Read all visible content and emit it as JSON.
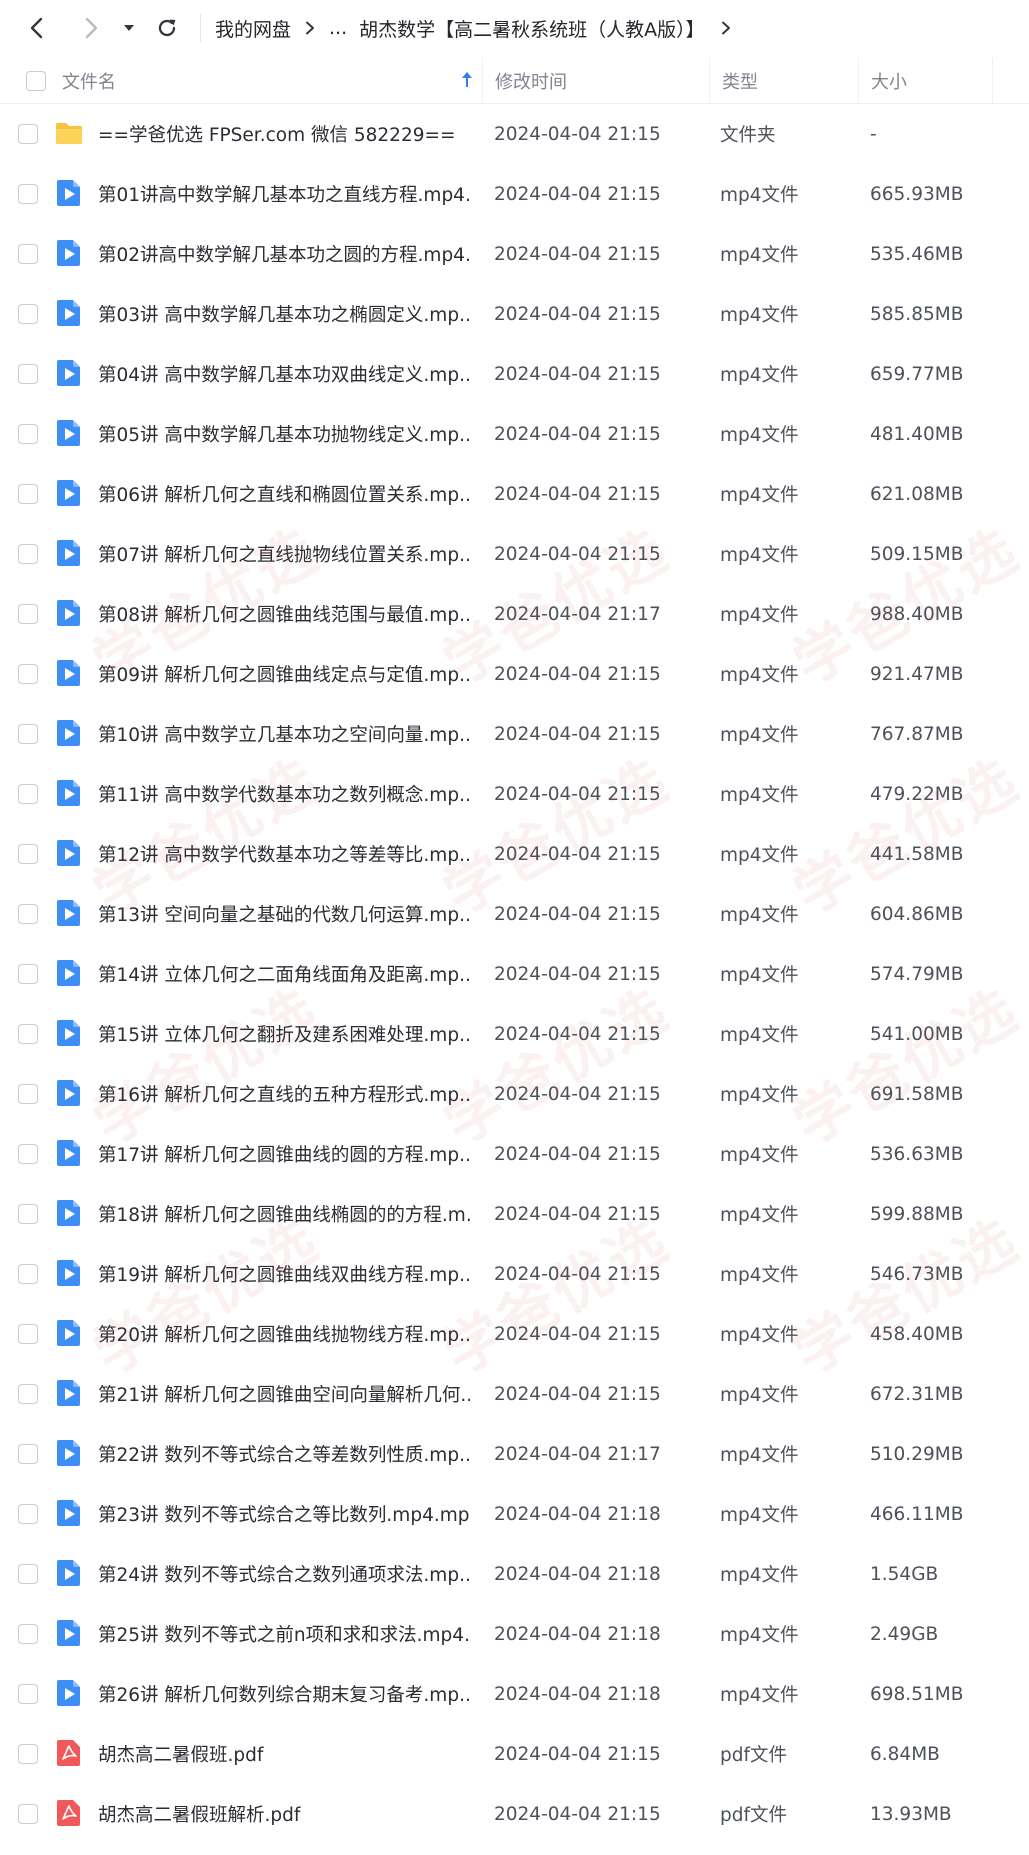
{
  "breadcrumb": {
    "root": "我的网盘",
    "ellipsis": "...",
    "current": "胡杰数学【高二暑秋系统班（人教A版）】"
  },
  "header": {
    "name": "文件名",
    "mtime": "修改时间",
    "type": "类型",
    "size": "大小"
  },
  "rows": [
    {
      "name": "==学爸优选 FPSer.com 微信 582229==",
      "mtime": "2024-04-04 21:15",
      "type": "文件夹",
      "size": "-",
      "icon": "folder"
    },
    {
      "name": "第01讲高中数学解几基本功之直线方程.mp4...",
      "mtime": "2024-04-04 21:15",
      "type": "mp4文件",
      "size": "665.93MB",
      "icon": "video"
    },
    {
      "name": "第02讲高中数学解几基本功之圆的方程.mp4...",
      "mtime": "2024-04-04 21:15",
      "type": "mp4文件",
      "size": "535.46MB",
      "icon": "video"
    },
    {
      "name": "第03讲 高中数学解几基本功之椭圆定义.mp...",
      "mtime": "2024-04-04 21:15",
      "type": "mp4文件",
      "size": "585.85MB",
      "icon": "video"
    },
    {
      "name": "第04讲 高中数学解几基本功双曲线定义.mp...",
      "mtime": "2024-04-04 21:15",
      "type": "mp4文件",
      "size": "659.77MB",
      "icon": "video"
    },
    {
      "name": "第05讲 高中数学解几基本功抛物线定义.mp...",
      "mtime": "2024-04-04 21:15",
      "type": "mp4文件",
      "size": "481.40MB",
      "icon": "video"
    },
    {
      "name": "第06讲 解析几何之直线和椭圆位置关系.mp...",
      "mtime": "2024-04-04 21:15",
      "type": "mp4文件",
      "size": "621.08MB",
      "icon": "video"
    },
    {
      "name": "第07讲 解析几何之直线抛物线位置关系.mp...",
      "mtime": "2024-04-04 21:15",
      "type": "mp4文件",
      "size": "509.15MB",
      "icon": "video"
    },
    {
      "name": "第08讲 解析几何之圆锥曲线范围与最值.mp...",
      "mtime": "2024-04-04 21:17",
      "type": "mp4文件",
      "size": "988.40MB",
      "icon": "video"
    },
    {
      "name": "第09讲 解析几何之圆锥曲线定点与定值.mp...",
      "mtime": "2024-04-04 21:15",
      "type": "mp4文件",
      "size": "921.47MB",
      "icon": "video"
    },
    {
      "name": "第10讲 高中数学立几基本功之空间向量.mp...",
      "mtime": "2024-04-04 21:15",
      "type": "mp4文件",
      "size": "767.87MB",
      "icon": "video"
    },
    {
      "name": "第11讲 高中数学代数基本功之数列概念.mp...",
      "mtime": "2024-04-04 21:15",
      "type": "mp4文件",
      "size": "479.22MB",
      "icon": "video"
    },
    {
      "name": "第12讲 高中数学代数基本功之等差等比.mp...",
      "mtime": "2024-04-04 21:15",
      "type": "mp4文件",
      "size": "441.58MB",
      "icon": "video"
    },
    {
      "name": "第13讲 空间向量之基础的代数几何运算.mp...",
      "mtime": "2024-04-04 21:15",
      "type": "mp4文件",
      "size": "604.86MB",
      "icon": "video"
    },
    {
      "name": "第14讲 立体几何之二面角线面角及距离.mp...",
      "mtime": "2024-04-04 21:15",
      "type": "mp4文件",
      "size": "574.79MB",
      "icon": "video"
    },
    {
      "name": "第15讲 立体几何之翻折及建系困难处理.mp...",
      "mtime": "2024-04-04 21:15",
      "type": "mp4文件",
      "size": "541.00MB",
      "icon": "video"
    },
    {
      "name": "第16讲 解析几何之直线的五种方程形式.mp...",
      "mtime": "2024-04-04 21:15",
      "type": "mp4文件",
      "size": "691.58MB",
      "icon": "video"
    },
    {
      "name": "第17讲 解析几何之圆锥曲线的圆的方程.mp...",
      "mtime": "2024-04-04 21:15",
      "type": "mp4文件",
      "size": "536.63MB",
      "icon": "video"
    },
    {
      "name": "第18讲 解析几何之圆锥曲线椭圆的的方程.m...",
      "mtime": "2024-04-04 21:15",
      "type": "mp4文件",
      "size": "599.88MB",
      "icon": "video"
    },
    {
      "name": "第19讲 解析几何之圆锥曲线双曲线方程.mp...",
      "mtime": "2024-04-04 21:15",
      "type": "mp4文件",
      "size": "546.73MB",
      "icon": "video"
    },
    {
      "name": "第20讲 解析几何之圆锥曲线抛物线方程.mp...",
      "mtime": "2024-04-04 21:15",
      "type": "mp4文件",
      "size": "458.40MB",
      "icon": "video"
    },
    {
      "name": "第21讲 解析几何之圆锥曲空间向量解析几何...",
      "mtime": "2024-04-04 21:15",
      "type": "mp4文件",
      "size": "672.31MB",
      "icon": "video"
    },
    {
      "name": "第22讲 数列不等式综合之等差数列性质.mp...",
      "mtime": "2024-04-04 21:17",
      "type": "mp4文件",
      "size": "510.29MB",
      "icon": "video"
    },
    {
      "name": "第23讲 数列不等式综合之等比数列.mp4.mp4",
      "mtime": "2024-04-04 21:18",
      "type": "mp4文件",
      "size": "466.11MB",
      "icon": "video"
    },
    {
      "name": "第24讲 数列不等式综合之数列通项求法.mp...",
      "mtime": "2024-04-04 21:18",
      "type": "mp4文件",
      "size": "1.54GB",
      "icon": "video"
    },
    {
      "name": "第25讲 数列不等式之前n项和求和求法.mp4....",
      "mtime": "2024-04-04 21:18",
      "type": "mp4文件",
      "size": "2.49GB",
      "icon": "video"
    },
    {
      "name": "第26讲 解析几何数列综合期末复习备考.mp...",
      "mtime": "2024-04-04 21:18",
      "type": "mp4文件",
      "size": "698.51MB",
      "icon": "video"
    },
    {
      "name": "胡杰高二暑假班.pdf",
      "mtime": "2024-04-04 21:15",
      "type": "pdf文件",
      "size": "6.84MB",
      "icon": "pdf"
    },
    {
      "name": "胡杰高二暑假班解析.pdf",
      "mtime": "2024-04-04 21:15",
      "type": "pdf文件",
      "size": "13.93MB",
      "icon": "pdf"
    }
  ],
  "colors": {
    "video_icon": "#3d8ef5",
    "folder_icon": "#f7c33f",
    "pdf_icon": "#f0585a",
    "sort_arrow": "#2f7cf6"
  },
  "icons": {
    "back": "chevron-left-icon",
    "forward": "chevron-right-icon",
    "history": "caret-down-icon",
    "refresh": "refresh-icon",
    "sort": "sort-up-arrow-icon"
  }
}
